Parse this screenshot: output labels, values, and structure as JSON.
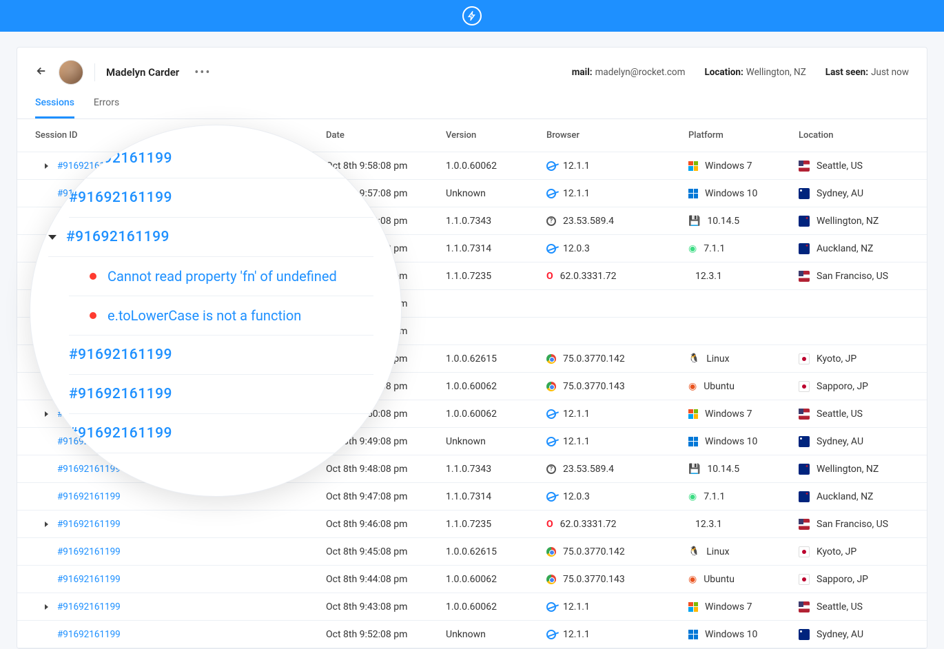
{
  "user": {
    "name": "Madelyn Carder",
    "mail_label": "mail:",
    "mail_value": "madelyn@rocket.com",
    "location_label": "Location:",
    "location_value": "Wellington, NZ",
    "lastseen_label": "Last seen:",
    "lastseen_value": "Just now"
  },
  "tabs": {
    "sessions": "Sessions",
    "errors": "Errors"
  },
  "columns": {
    "session_id": "Session ID",
    "date": "Date",
    "version": "Version",
    "browser": "Browser",
    "platform": "Platform",
    "location": "Location"
  },
  "sessions": [
    {
      "expandable": true,
      "id": "#91692161199",
      "date": "Oct 8th 9:58:08 pm",
      "version": "1.0.0.60062",
      "browser_icon": "ie",
      "browser": "12.1.1",
      "platform_icon": "win7",
      "platform": "Windows 7",
      "flag": "us",
      "location": "Seattle, US"
    },
    {
      "expandable": false,
      "id": "#91692161199",
      "date": "Oct 8th 9:57:08 pm",
      "version": "Unknown",
      "browser_icon": "ie",
      "browser": "12.1.1",
      "platform_icon": "win10",
      "platform": "Windows 10",
      "flag": "au",
      "location": "Sydney, AU"
    },
    {
      "expandable": false,
      "id": "#91692161199",
      "date": "Oct 8th 9:56:08 pm",
      "version": "1.1.0.7343",
      "browser_icon": "q",
      "browser": "23.53.589.4",
      "platform_icon": "mac",
      "platform": "10.14.5",
      "flag": "nz",
      "location": "Wellington, NZ"
    },
    {
      "expandable": false,
      "id": "#91692161199",
      "date": "Oct 8th 9:55:08 pm",
      "version": "1.1.0.7314",
      "browser_icon": "ie",
      "browser": "12.0.3",
      "platform_icon": "android",
      "platform": "7.1.1",
      "flag": "nz",
      "location": "Auckland, NZ"
    },
    {
      "expandable": false,
      "id": "#91692161199",
      "date": "Oct 8th 9:54:08 pm",
      "version": "1.1.0.7235",
      "browser_icon": "opera",
      "browser": "62.0.3331.72",
      "platform_icon": "apple",
      "platform": "12.3.1",
      "flag": "us",
      "location": "San Franciso, US"
    },
    {
      "expandable": false,
      "id": "#91692161199",
      "date": "Oct 8th 9:53:08 pm",
      "version": "",
      "browser_icon": "",
      "browser": "",
      "platform_icon": "",
      "platform": "",
      "flag": "",
      "location": ""
    },
    {
      "expandable": false,
      "id": "#91692161199",
      "date": "Oct 8th 9:52:08 pm",
      "version": "",
      "browser_icon": "",
      "browser": "",
      "platform_icon": "",
      "platform": "",
      "flag": "",
      "location": ""
    },
    {
      "expandable": false,
      "id": "#91692161199",
      "date": "Oct 8th 9:52:08 pm",
      "version": "1.0.0.62615",
      "browser_icon": "chrome",
      "browser": "75.0.3770.142",
      "platform_icon": "linux",
      "platform": "Linux",
      "flag": "jp",
      "location": "Kyoto, JP"
    },
    {
      "expandable": false,
      "id": "#91692161199",
      "date": "Oct 8th 9:51:08 pm",
      "version": "1.0.0.60062",
      "browser_icon": "chrome",
      "browser": "75.0.3770.143",
      "platform_icon": "ubuntu",
      "platform": "Ubuntu",
      "flag": "jp",
      "location": "Sapporo, JP"
    },
    {
      "expandable": true,
      "id": "#91692161199",
      "date": "Oct 8th 9:50:08 pm",
      "version": "1.0.0.60062",
      "browser_icon": "ie",
      "browser": "12.1.1",
      "platform_icon": "win7",
      "platform": "Windows 7",
      "flag": "us",
      "location": "Seattle, US"
    },
    {
      "expandable": false,
      "id": "#91692161199",
      "date": "Oct 8th 9:49:08 pm",
      "version": "Unknown",
      "browser_icon": "ie",
      "browser": "12.1.1",
      "platform_icon": "win10",
      "platform": "Windows 10",
      "flag": "au",
      "location": "Sydney, AU"
    },
    {
      "expandable": false,
      "id": "#91692161199",
      "date": "Oct 8th 9:48:08 pm",
      "version": "1.1.0.7343",
      "browser_icon": "q",
      "browser": "23.53.589.4",
      "platform_icon": "mac",
      "platform": "10.14.5",
      "flag": "nz",
      "location": "Wellington, NZ"
    },
    {
      "expandable": false,
      "id": "#91692161199",
      "date": "Oct 8th 9:47:08 pm",
      "version": "1.1.0.7314",
      "browser_icon": "ie",
      "browser": "12.0.3",
      "platform_icon": "android",
      "platform": "7.1.1",
      "flag": "nz",
      "location": "Auckland, NZ"
    },
    {
      "expandable": true,
      "id": "#91692161199",
      "date": "Oct 8th 9:46:08 pm",
      "version": "1.1.0.7235",
      "browser_icon": "opera",
      "browser": "62.0.3331.72",
      "platform_icon": "apple",
      "platform": "12.3.1",
      "flag": "us",
      "location": "San Franciso, US"
    },
    {
      "expandable": false,
      "id": "#91692161199",
      "date": "Oct 8th 9:45:08 pm",
      "version": "1.0.0.62615",
      "browser_icon": "chrome",
      "browser": "75.0.3770.142",
      "platform_icon": "linux",
      "platform": "Linux",
      "flag": "jp",
      "location": "Kyoto, JP"
    },
    {
      "expandable": false,
      "id": "#91692161199",
      "date": "Oct 8th 9:44:08 pm",
      "version": "1.0.0.60062",
      "browser_icon": "chrome",
      "browser": "75.0.3770.143",
      "platform_icon": "ubuntu",
      "platform": "Ubuntu",
      "flag": "jp",
      "location": "Sapporo, JP"
    },
    {
      "expandable": true,
      "id": "#91692161199",
      "date": "Oct 8th 9:43:08 pm",
      "version": "1.0.0.60062",
      "browser_icon": "ie",
      "browser": "12.1.1",
      "platform_icon": "win7",
      "platform": "Windows 7",
      "flag": "us",
      "location": "Seattle, US"
    },
    {
      "expandable": false,
      "id": "#91692161199",
      "date": "Oct 8th 9:52:08 pm",
      "version": "Unknown",
      "browser_icon": "ie",
      "browser": "12.1.1",
      "platform_icon": "win10",
      "platform": "Windows 10",
      "flag": "au",
      "location": "Sydney, AU"
    }
  ],
  "magnifier": {
    "rows": [
      {
        "type": "sid",
        "text": "#91692161199"
      },
      {
        "type": "sid",
        "text": "#91692161199"
      },
      {
        "type": "sid_expanded",
        "text": "#91692161199"
      },
      {
        "type": "err",
        "text": "Cannot read property 'fn' of undefined"
      },
      {
        "type": "err",
        "text": "e.toLowerCase is not a function"
      },
      {
        "type": "sid",
        "text": "#91692161199"
      },
      {
        "type": "sid",
        "text": "#91692161199"
      },
      {
        "type": "sid",
        "text": "#91692161199"
      }
    ]
  }
}
